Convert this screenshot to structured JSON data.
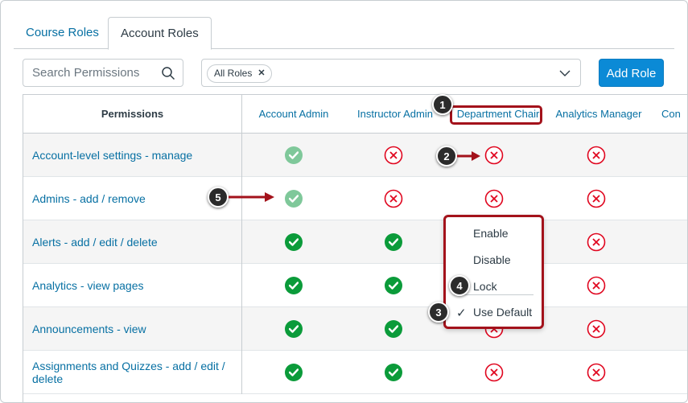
{
  "tabs": [
    {
      "label": "Course Roles"
    },
    {
      "label": "Account Roles"
    }
  ],
  "search": {
    "placeholder": "Search Permissions"
  },
  "roles_filter": {
    "pill": "All Roles"
  },
  "add_role_label": "Add Role",
  "table": {
    "permissions_header": "Permissions",
    "roles": [
      "Account Admin",
      "Instructor Admin",
      "Department Chair",
      "Analytics Manager",
      "Con"
    ],
    "rows": [
      {
        "name": "Account-level settings - manage",
        "states": [
          "enabled-dim",
          "disabled",
          "disabled",
          "disabled"
        ]
      },
      {
        "name": "Admins - add / remove",
        "states": [
          "enabled-dim",
          "disabled",
          "disabled",
          "disabled"
        ]
      },
      {
        "name": "Alerts - add / edit / delete",
        "states": [
          "enabled",
          "enabled",
          "hidden",
          "disabled"
        ]
      },
      {
        "name": "Analytics - view pages",
        "states": [
          "enabled",
          "enabled",
          "hidden",
          "disabled"
        ]
      },
      {
        "name": "Announcements - view",
        "states": [
          "enabled",
          "enabled",
          "disabled",
          "disabled"
        ]
      },
      {
        "name": "Assignments and Quizzes - add / edit / delete",
        "states": [
          "enabled",
          "enabled",
          "disabled",
          "disabled"
        ]
      }
    ]
  },
  "menu": {
    "items": [
      "Enable",
      "Disable",
      "Lock",
      "Use Default"
    ],
    "checked": "Use Default"
  },
  "callouts": [
    "1",
    "2",
    "3",
    "4",
    "5"
  ],
  "colors": {
    "link": "#0770a3",
    "check_enabled": "#0b9b3a",
    "check_dim": "#7fc89a",
    "disabled_x": "#e0061f",
    "annotation": "#a3121b",
    "button": "#0b8ad6"
  }
}
